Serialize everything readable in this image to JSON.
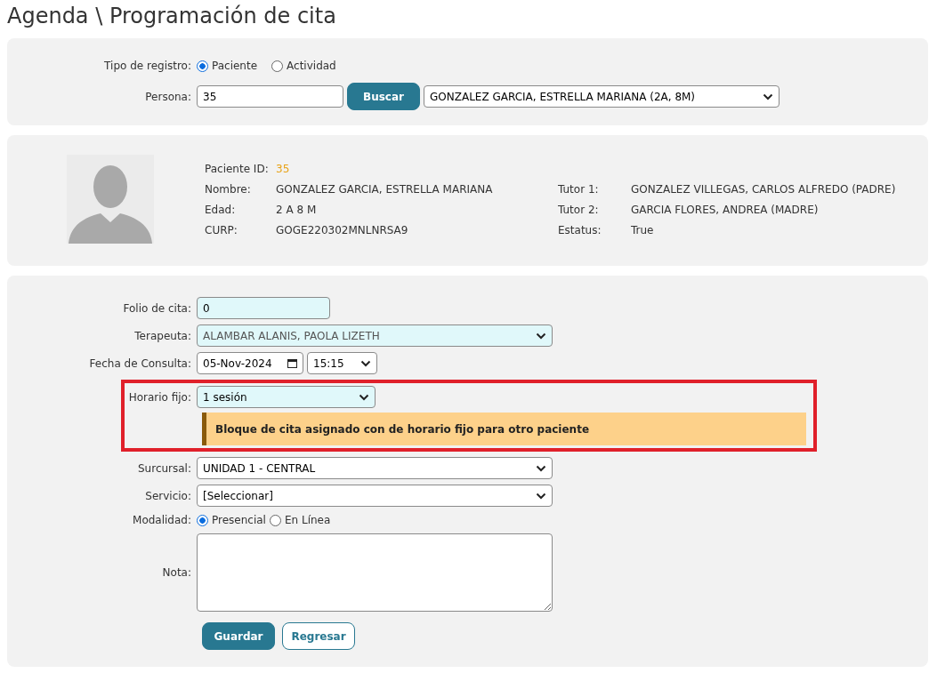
{
  "page_title": "Agenda \\ Programación de cita",
  "search_panel": {
    "record_type_label": "Tipo de registro:",
    "record_types": [
      {
        "label": "Paciente",
        "selected": true
      },
      {
        "label": "Actividad",
        "selected": false
      }
    ],
    "person_label": "Persona:",
    "person_value": "35",
    "search_button": "Buscar",
    "person_select": "GONZALEZ GARCIA, ESTRELLA MARIANA (2A, 8M)"
  },
  "patient": {
    "rows": [
      {
        "label": "Paciente ID:",
        "value": "35",
        "kind": "highlight"
      },
      {
        "label": "Nombre:",
        "value": "GONZALEZ GARCIA, ESTRELLA MARIANA",
        "kind": "plain",
        "right_label": "Tutor 1:",
        "right_value": "GONZALEZ VILLEGAS, CARLOS ALFREDO (PADRE)"
      },
      {
        "label": "Edad:",
        "value": "2 A 8 M",
        "kind": "plain",
        "right_label": "Tutor 2:",
        "right_value": "GARCIA FLORES, ANDREA (MADRE)"
      },
      {
        "label": "CURP:",
        "value": "GOGE220302MNLNRSA9",
        "kind": "plain",
        "right_label": "Estatus:",
        "right_value": "True"
      }
    ]
  },
  "form": {
    "fields": [
      {
        "kind": "input",
        "label": "Folio de cita:",
        "value": "0",
        "tinted": true
      },
      {
        "kind": "select",
        "label": "Terapeuta:",
        "value": "ALAMBAR ALANIS, PAOLA LIZETH",
        "tinted": true,
        "disabled": true
      },
      {
        "kind": "datetime",
        "label": "Fecha de Consulta:",
        "value": "05-Nov-2024",
        "time": "15:15"
      },
      {
        "kind": "short-select",
        "label": "Horario fijo:",
        "value": "1 sesión",
        "tinted": true,
        "highlighted": true,
        "alert": "Bloque de cita asignado con de horario fijo para otro paciente"
      },
      {
        "kind": "select",
        "label": "Surcursal:",
        "value": "UNIDAD 1 - CENTRAL"
      },
      {
        "kind": "select",
        "label": "Servicio:",
        "value": "[Seleccionar]"
      },
      {
        "kind": "radio",
        "label": "Modalidad:",
        "options": [
          {
            "label": "Presencial",
            "selected": true
          },
          {
            "label": "En Línea",
            "selected": false
          }
        ]
      },
      {
        "kind": "textarea",
        "label": "Nota:"
      }
    ],
    "buttons": [
      {
        "label": "Guardar",
        "kind": "primary"
      },
      {
        "label": "Regresar",
        "kind": "outline"
      }
    ]
  }
}
